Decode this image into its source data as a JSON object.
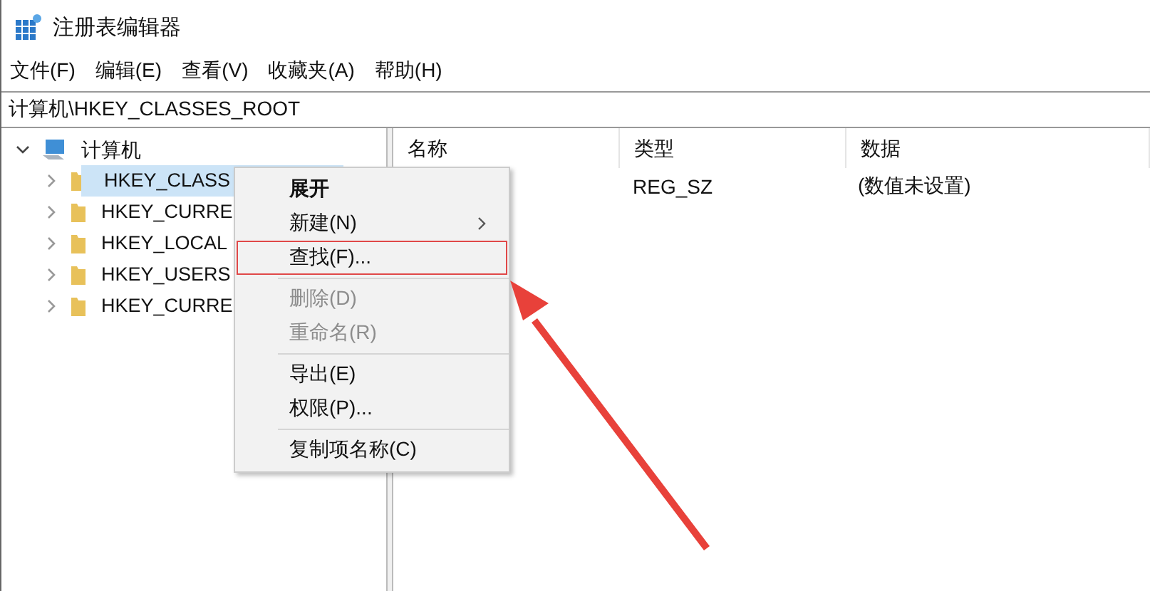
{
  "window": {
    "title": "注册表编辑器"
  },
  "menu_bar": [
    {
      "label": "文件(F)"
    },
    {
      "label": "编辑(E)"
    },
    {
      "label": "查看(V)"
    },
    {
      "label": "收藏夹(A)"
    },
    {
      "label": "帮助(H)"
    }
  ],
  "address": "计算机\\HKEY_CLASSES_ROOT",
  "tree": {
    "label": "计算机",
    "expanded": true,
    "children": [
      {
        "label": "HKEY_CLASS",
        "selected": true,
        "expanded": false
      },
      {
        "label": "HKEY_CURRE",
        "selected": false,
        "expanded": false
      },
      {
        "label": "HKEY_LOCAL",
        "selected": false,
        "expanded": false
      },
      {
        "label": "HKEY_USERS",
        "selected": false,
        "expanded": false
      },
      {
        "label": "HKEY_CURRE",
        "selected": false,
        "expanded": false
      }
    ]
  },
  "table": {
    "columns": [
      "名称",
      "类型",
      "数据"
    ],
    "rows": [
      {
        "type": "REG_SZ",
        "data": "(数值未设置)"
      }
    ]
  },
  "context_menu": [
    {
      "kind": "item",
      "label": "展开",
      "default": true,
      "disabled": false,
      "submenu": false,
      "highlighted": false
    },
    {
      "kind": "item",
      "label": "新建(N)",
      "default": false,
      "disabled": false,
      "submenu": true,
      "highlighted": false
    },
    {
      "kind": "item",
      "label": "查找(F)...",
      "default": false,
      "disabled": false,
      "submenu": false,
      "highlighted": true
    },
    {
      "kind": "separator"
    },
    {
      "kind": "item",
      "label": "删除(D)",
      "default": false,
      "disabled": true,
      "submenu": false,
      "highlighted": false
    },
    {
      "kind": "item",
      "label": "重命名(R)",
      "default": false,
      "disabled": true,
      "submenu": false,
      "highlighted": false
    },
    {
      "kind": "separator"
    },
    {
      "kind": "item",
      "label": "导出(E)",
      "default": false,
      "disabled": false,
      "submenu": false,
      "highlighted": false
    },
    {
      "kind": "item",
      "label": "权限(P)...",
      "default": false,
      "disabled": false,
      "submenu": false,
      "highlighted": false
    },
    {
      "kind": "separator"
    },
    {
      "kind": "item",
      "label": "复制项名称(C)",
      "default": false,
      "disabled": false,
      "submenu": false,
      "highlighted": false
    }
  ]
}
